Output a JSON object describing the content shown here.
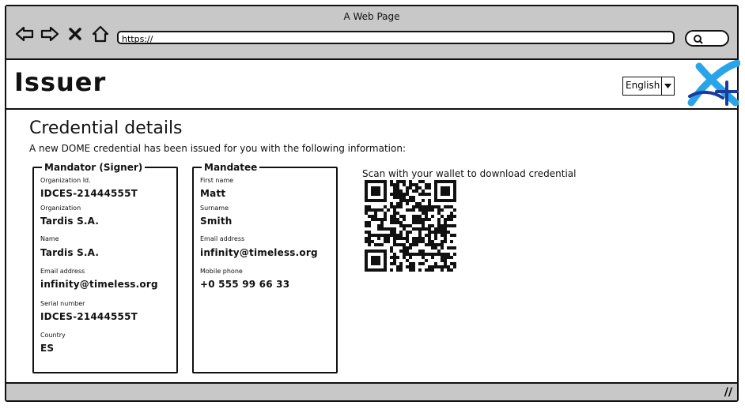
{
  "window": {
    "title": "A Web Page"
  },
  "browser": {
    "url": "https://",
    "icons": [
      "back-arrow-icon",
      "forward-arrow-icon",
      "close-icon",
      "home-icon",
      "search-icon"
    ]
  },
  "header": {
    "app_title": "Issuer",
    "language": "English"
  },
  "main": {
    "title": "Credential details",
    "intro": "A new DOME credential has been issued for you with the following information:",
    "mandator": {
      "legend": "Mandator (Signer)",
      "fields": [
        {
          "label": "Organization Id.",
          "value": "IDCES-21444555T"
        },
        {
          "label": "Organization",
          "value": "Tardis S.A."
        },
        {
          "label": "Name",
          "value": "Tardis S.A."
        },
        {
          "label": "Email address",
          "value": "infinity@timeless.org"
        },
        {
          "label": "Serial number",
          "value": "IDCES-21444555T"
        },
        {
          "label": "Country",
          "value": "ES"
        }
      ]
    },
    "mandatee": {
      "legend": "Mandatee",
      "fields": [
        {
          "label": "First name",
          "value": "Matt"
        },
        {
          "label": "Surname",
          "value": "Smith"
        },
        {
          "label": "Email address",
          "value": "infinity@timeless.org"
        },
        {
          "label": "Mobile phone",
          "value": "+0 555 99 66 33"
        }
      ]
    },
    "qr_label": "Scan with your wallet to download credential"
  },
  "colors": {
    "chrome": "#c8c8c8",
    "logo_blue": "#2aa4e8",
    "logo_dark": "#1a3a9c"
  }
}
